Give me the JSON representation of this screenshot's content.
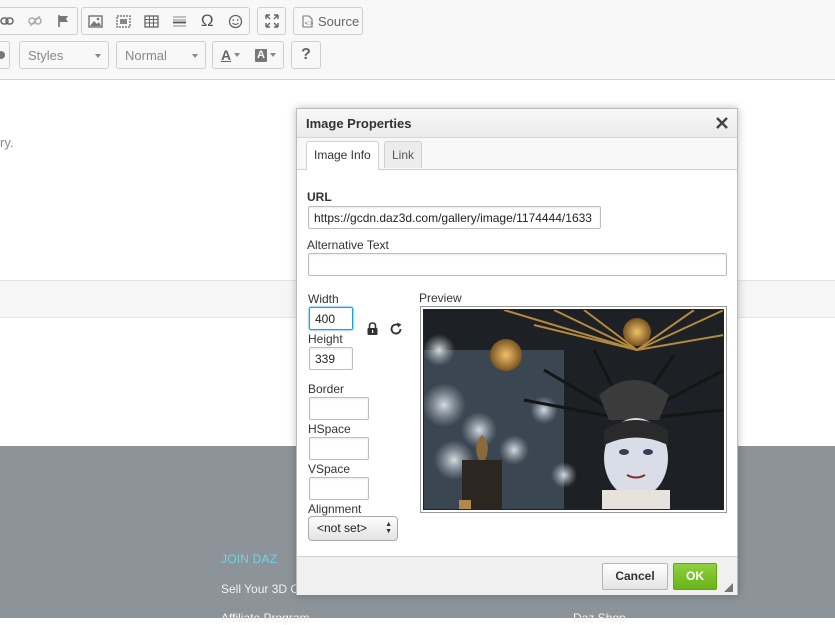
{
  "toolbar": {
    "source_label": "Source",
    "styles_label": "Styles",
    "format_label": "Normal",
    "text_color_glyph": "A",
    "bg_color_glyph": "A",
    "help_glyph": "?",
    "omega_glyph": "Ω"
  },
  "page": {
    "fragment_text": "ry.",
    "footer": {
      "join_label": "JOIN DAZ",
      "sell_label": "Sell Your 3D C",
      "affiliate_label": "Affiliate Program",
      "shop_label": "Daz Shop"
    }
  },
  "dialog": {
    "title": "Image Properties",
    "tabs": [
      {
        "label": "Image Info",
        "active": true
      },
      {
        "label": "Link",
        "active": false
      }
    ],
    "url_label": "URL",
    "url_value": "https://gcdn.daz3d.com/gallery/image/1174444/1633",
    "alt_label": "Alternative Text",
    "alt_value": "",
    "width_label": "Width",
    "width_value": "400",
    "height_label": "Height",
    "height_value": "339",
    "border_label": "Border",
    "border_value": "",
    "hspace_label": "HSpace",
    "hspace_value": "",
    "vspace_label": "VSpace",
    "vspace_value": "",
    "alignment_label": "Alignment",
    "alignment_value": "<not set>",
    "preview_label": "Preview",
    "cancel_label": "Cancel",
    "ok_label": "OK"
  },
  "colors": {
    "ok_green": "#76bf22",
    "focus_blue": "#139ff7",
    "footer_bg": "#8c9399",
    "join_cyan": "#6fd4e6"
  },
  "icons": {
    "close": "close-icon",
    "lock": "lock-icon",
    "reset": "reset-size-icon"
  }
}
